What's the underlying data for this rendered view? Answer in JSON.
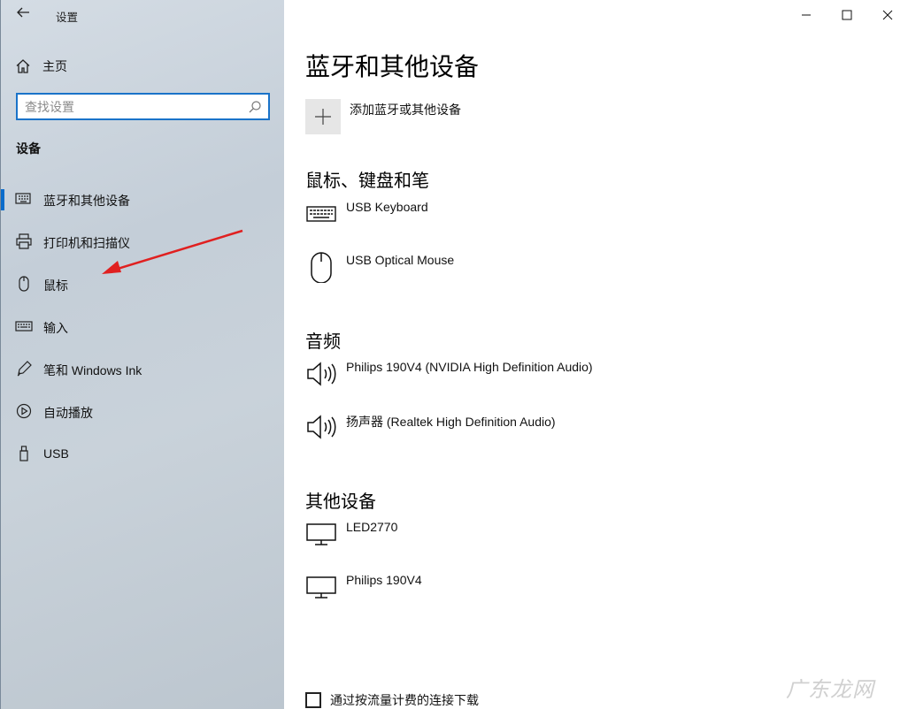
{
  "window": {
    "title": "设置",
    "controls": {
      "minimize": "minimize-icon",
      "maximize": "maximize-icon",
      "close": "close-icon"
    }
  },
  "sidebar": {
    "home_label": "主页",
    "search": {
      "placeholder": "查找设置",
      "value": ""
    },
    "section_heading": "设备",
    "items": [
      {
        "label": "蓝牙和其他设备",
        "icon": "bluetooth-devices-icon",
        "selected": true
      },
      {
        "label": "打印机和扫描仪",
        "icon": "printer-icon",
        "selected": false
      },
      {
        "label": "鼠标",
        "icon": "mouse-icon",
        "selected": false
      },
      {
        "label": "输入",
        "icon": "keyboard-icon",
        "selected": false
      },
      {
        "label": "笔和 Windows Ink",
        "icon": "pen-icon",
        "selected": false
      },
      {
        "label": "自动播放",
        "icon": "autoplay-icon",
        "selected": false
      },
      {
        "label": "USB",
        "icon": "usb-icon",
        "selected": false
      }
    ]
  },
  "main": {
    "page_title": "蓝牙和其他设备",
    "add_device_label": "添加蓝牙或其他设备",
    "groups": [
      {
        "title": "鼠标、键盘和笔",
        "devices": [
          {
            "name": "USB Keyboard",
            "icon": "keyboard-icon"
          },
          {
            "name": "USB Optical Mouse",
            "icon": "mouse-icon"
          }
        ]
      },
      {
        "title": "音频",
        "devices": [
          {
            "name": "Philips 190V4 (NVIDIA High Definition Audio)",
            "icon": "speaker-icon"
          },
          {
            "name": "扬声器 (Realtek High Definition Audio)",
            "icon": "speaker-icon"
          }
        ]
      },
      {
        "title": "其他设备",
        "devices": [
          {
            "name": "LED2770",
            "icon": "monitor-icon"
          },
          {
            "name": "Philips 190V4",
            "icon": "monitor-icon"
          }
        ]
      }
    ],
    "metered_download_label": "通过按流量计费的连接下载",
    "metered_download_checked": false
  },
  "watermark": "广东龙网",
  "colors": {
    "accent": "#0a6ccb",
    "arrow": "#e02020",
    "tile": "#e6e6e6"
  }
}
